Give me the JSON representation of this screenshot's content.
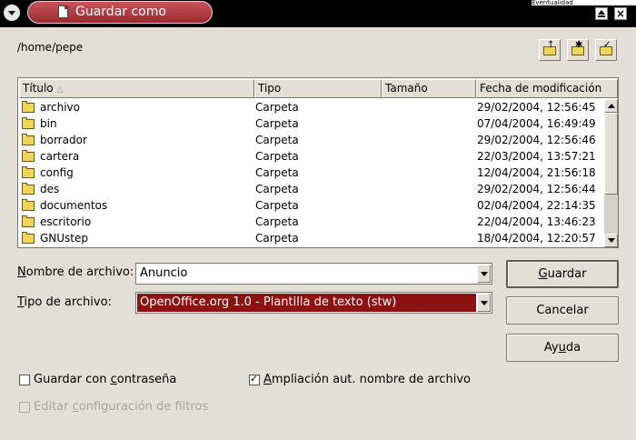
{
  "window": {
    "title": "Guardar como",
    "background_strip_text": "Eventualidad"
  },
  "toolbar": {
    "path": "/home/pepe",
    "buttons": [
      {
        "name": "up-one-level",
        "icon": "folder-up-icon"
      },
      {
        "name": "new-folder",
        "icon": "new-folder-icon"
      },
      {
        "name": "default-directory",
        "icon": "default-folder-icon"
      }
    ]
  },
  "file_list": {
    "columns": [
      "Título",
      "Tipo",
      "Tamaño",
      "Fecha de modificación"
    ],
    "rows": [
      {
        "name": "archivo",
        "type": "Carpeta",
        "date": "29/02/2004, 12:56:45"
      },
      {
        "name": "bin",
        "type": "Carpeta",
        "date": "07/04/2004, 16:49:49"
      },
      {
        "name": "borrador",
        "type": "Carpeta",
        "date": "29/02/2004, 12:56:46"
      },
      {
        "name": "cartera",
        "type": "Carpeta",
        "date": "22/03/2004, 13:57:21"
      },
      {
        "name": "config",
        "type": "Carpeta",
        "date": "12/04/2004, 21:56:18"
      },
      {
        "name": "des",
        "type": "Carpeta",
        "date": "29/02/2004, 12:56:44"
      },
      {
        "name": "documentos",
        "type": "Carpeta",
        "date": "02/04/2004, 22:14:35"
      },
      {
        "name": "escritorio",
        "type": "Carpeta",
        "date": "22/04/2004, 13:46:23"
      },
      {
        "name": "GNUstep",
        "type": "Carpeta",
        "date": "18/04/2004, 12:20:57"
      }
    ]
  },
  "form": {
    "filename_label_pre": "N",
    "filename_label_rest": "ombre de archivo:",
    "filename_value": "Anuncio",
    "filetype_label_pre": "T",
    "filetype_label_rest": "ipo de archivo:",
    "filetype_value": "OpenOffice.org 1.0 - Plantilla de texto (stw)"
  },
  "buttons": {
    "save_pre": "G",
    "save_rest": "uardar",
    "cancel": "Cancelar",
    "help_pre": "Ay",
    "help_u": "u",
    "help_rest": "da"
  },
  "options": {
    "password_pre": "Guardar con ",
    "password_u": "c",
    "password_rest": "ontraseña",
    "password_checked": false,
    "extension_pre": "",
    "extension_u": "A",
    "extension_rest": "mpliación aut. nombre de archivo",
    "extension_checked": true,
    "filter_pre": "Editar ",
    "filter_u": "c",
    "filter_rest": "onfiguración de filtros",
    "filter_checked": false,
    "filter_enabled": false
  },
  "colors": {
    "dialog_bg": "#e3dfd6",
    "title_pill": "#b23a41",
    "selection": "#8c1212"
  }
}
